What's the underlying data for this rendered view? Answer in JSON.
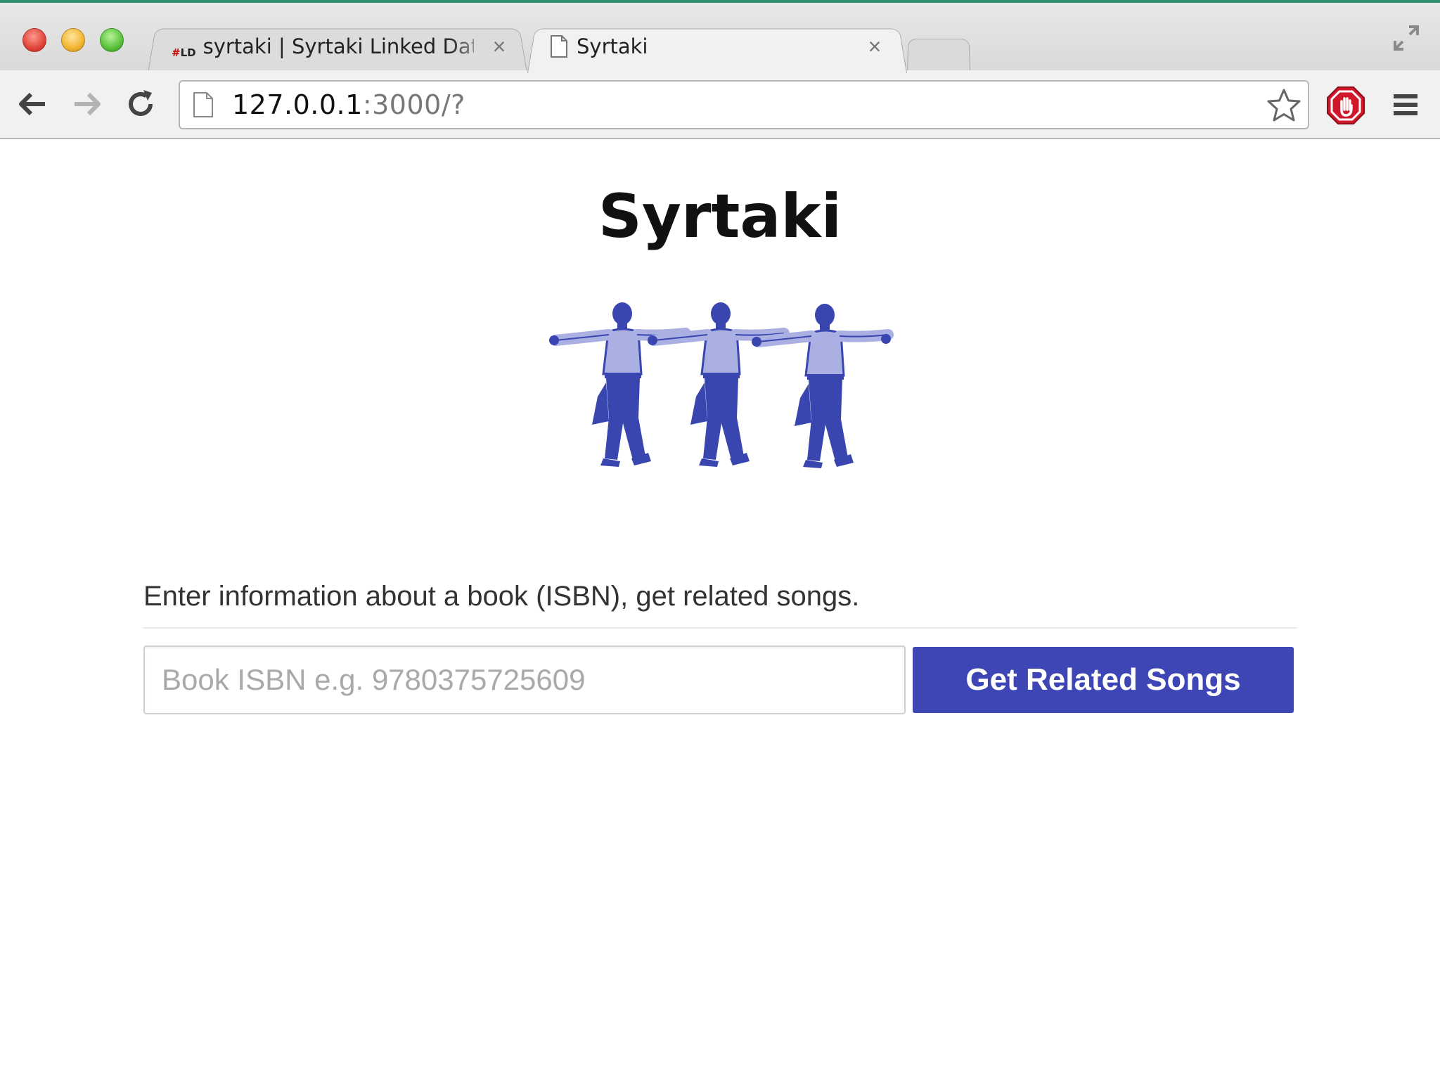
{
  "browser": {
    "tabs": [
      {
        "title": "syrtaki | Syrtaki Linked Data",
        "favicon_text": "LD",
        "favicon_hash": "#",
        "active": false
      },
      {
        "title": "Syrtaki",
        "active": true
      }
    ],
    "tab_close_glyph": "×",
    "url_host": "127.0.0.1",
    "url_rest": ":3000/?",
    "icons": {
      "back": "back-arrow-icon",
      "forward": "forward-arrow-icon",
      "reload": "reload-icon",
      "page": "page-icon",
      "bookmark": "star-icon",
      "extension": "stop-hand-icon",
      "menu": "hamburger-menu-icon",
      "fullscreen": "fullscreen-icon"
    },
    "colors": {
      "close_red": "#e0443a",
      "minimize_yellow": "#f2b533",
      "zoom_green": "#58c23a",
      "extension_red": "#d0182a"
    }
  },
  "page": {
    "title": "Syrtaki",
    "description": "Enter information about a book (ISBN), get related songs.",
    "isbn_placeholder": "Book ISBN e.g. 9780375725609",
    "isbn_value": "",
    "submit_label": "Get Related Songs",
    "colors": {
      "button_bg": "#3d46b4",
      "dancer_blue": "#3a46b0",
      "dancer_shirt": "#aab0e2"
    }
  }
}
